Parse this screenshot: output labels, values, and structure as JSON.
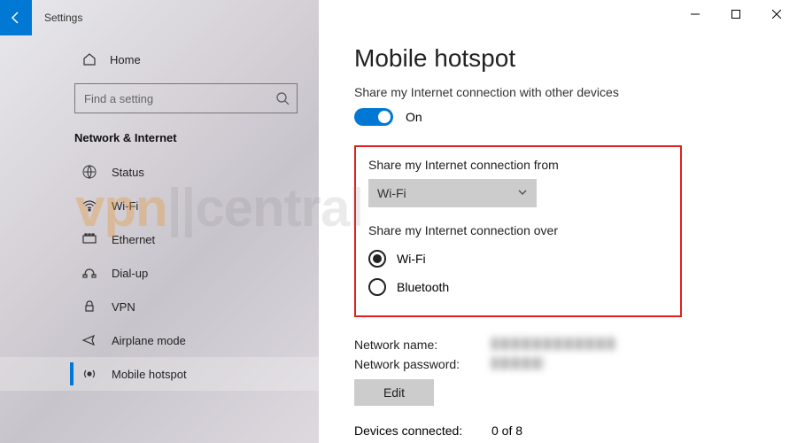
{
  "titlebar": {
    "title": "Settings"
  },
  "sidebar": {
    "home": "Home",
    "search_placeholder": "Find a setting",
    "heading": "Network & Internet",
    "items": [
      {
        "label": "Status"
      },
      {
        "label": "Wi-Fi"
      },
      {
        "label": "Ethernet"
      },
      {
        "label": "Dial-up"
      },
      {
        "label": "VPN"
      },
      {
        "label": "Airplane mode"
      },
      {
        "label": "Mobile hotspot"
      }
    ]
  },
  "main": {
    "title": "Mobile hotspot",
    "share_text": "Share my Internet connection with other devices",
    "toggle_state": "On",
    "from_label": "Share my Internet connection from",
    "from_value": "Wi-Fi",
    "over_label": "Share my Internet connection over",
    "over_options": [
      {
        "label": "Wi-Fi",
        "selected": true
      },
      {
        "label": "Bluetooth",
        "selected": false
      }
    ],
    "network_name_label": "Network name:",
    "network_password_label": "Network password:",
    "edit_label": "Edit",
    "devices_label": "Devices connected:",
    "devices_value": "0 of 8"
  }
}
